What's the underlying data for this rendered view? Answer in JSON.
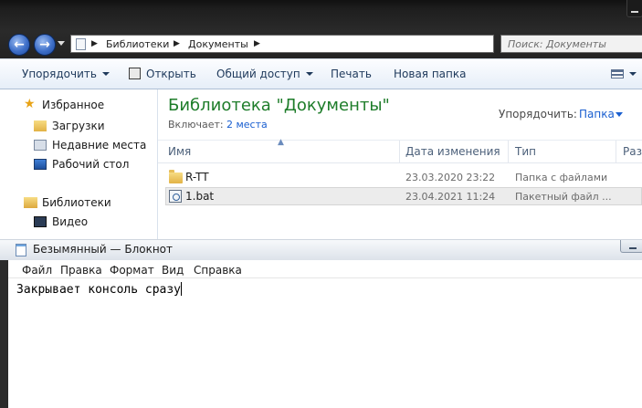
{
  "explorer": {
    "breadcrumb": [
      "Библиотеки",
      "Документы"
    ],
    "search_placeholder": "Поиск: Документы",
    "toolbar": {
      "organize": "Упорядочить",
      "open": "Открыть",
      "share": "Общий доступ",
      "print": "Печать",
      "new_folder": "Новая папка"
    },
    "nav": {
      "favorites": "Избранное",
      "downloads": "Загрузки",
      "recent": "Недавние места",
      "desktop": "Рабочий стол",
      "libraries": "Библиотеки",
      "video": "Видео"
    },
    "library_title": "Библиотека \"Документы\"",
    "includes_label": "Включает:",
    "includes_link": "2 места",
    "arrange_label": "Упорядочить:",
    "arrange_value": "Папка",
    "columns": {
      "name": "Имя",
      "date": "Дата изменения",
      "type": "Тип",
      "size": "Раз"
    },
    "files": [
      {
        "name": "R-TT",
        "date": "23.03.2020 23:22",
        "type": "Папка с файлами",
        "icon": "folder-icon"
      },
      {
        "name": "1.bat",
        "date": "23.04.2021 11:24",
        "type": "Пакетный файл ...",
        "icon": "batch-file-icon"
      }
    ]
  },
  "notepad": {
    "title": "Безымянный — Блокнот",
    "menu": [
      "Файл",
      "Правка",
      "Формат",
      "Вид",
      "Справка"
    ],
    "content": "Закрывает консоль сразу"
  }
}
